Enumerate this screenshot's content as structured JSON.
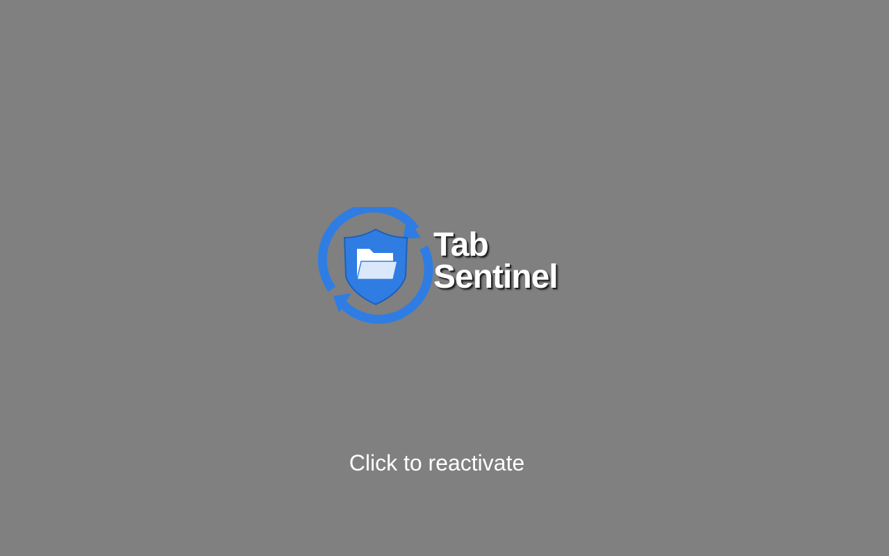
{
  "app": {
    "name_line1": "Tab",
    "name_line2": "Sentinel",
    "logo_icon": "shield-folder-sync-icon"
  },
  "overlay": {
    "message": "Click to reactivate"
  },
  "colors": {
    "background": "#808080",
    "accent_blue": "#2f7de3",
    "text": "#ffffff"
  }
}
